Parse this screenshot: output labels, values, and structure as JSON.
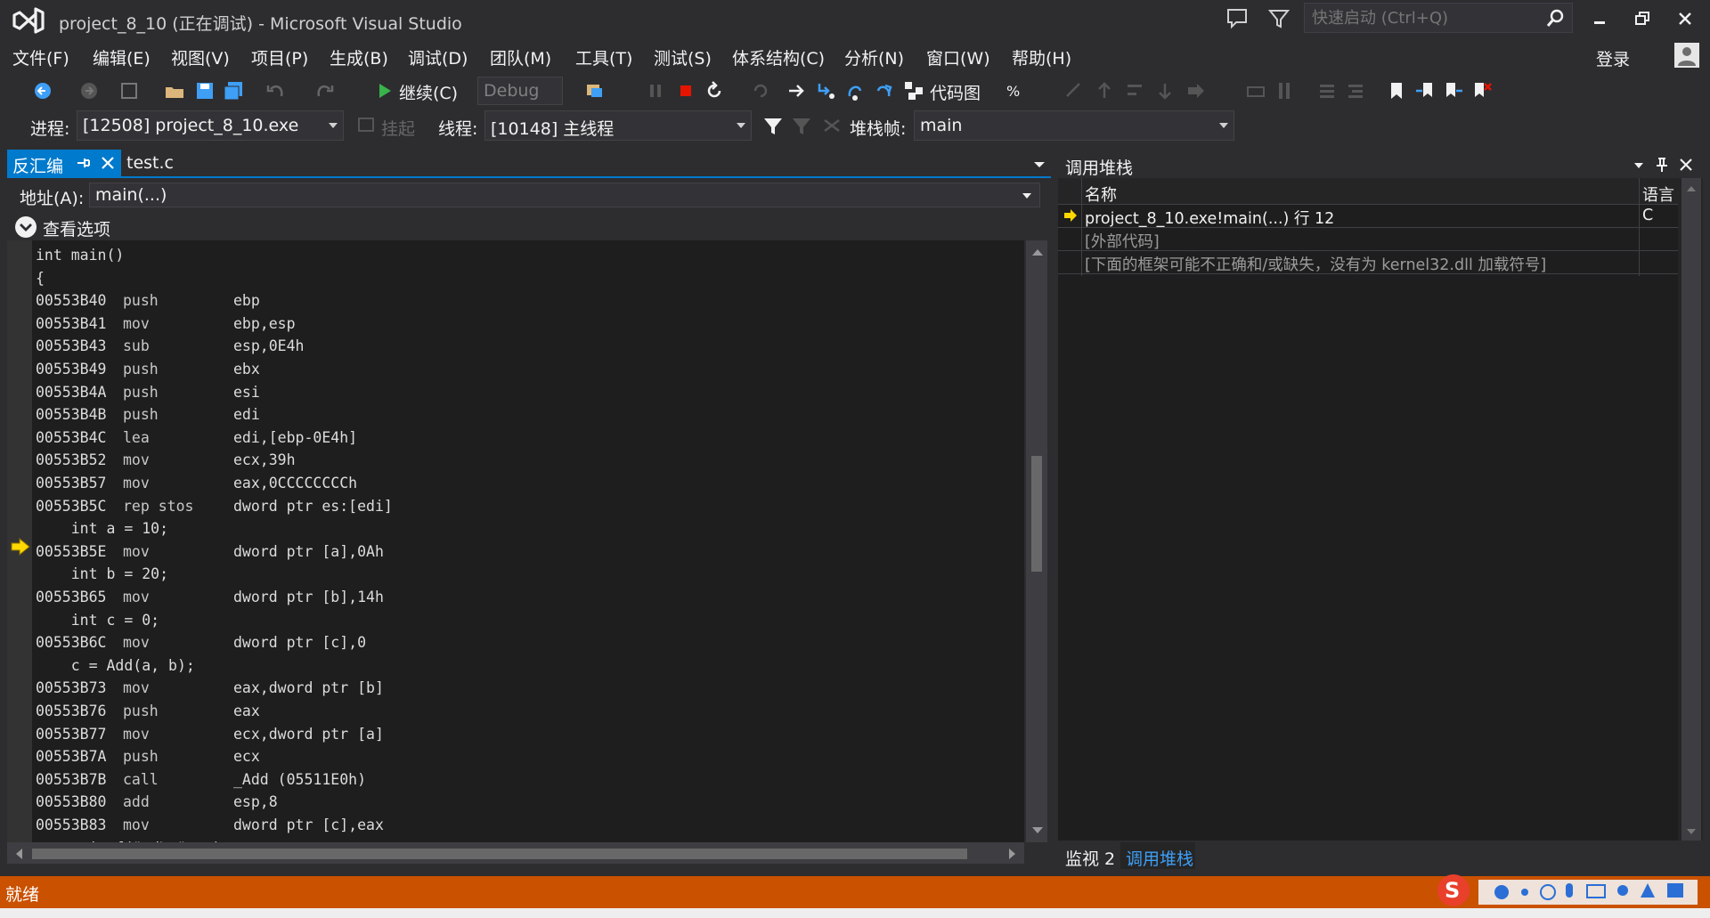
{
  "window": {
    "title": "project_8_10 (正在调试) - Microsoft Visual Studio"
  },
  "quick_launch": {
    "placeholder": "快速启动 (Ctrl+Q)"
  },
  "menu": [
    "文件(F)",
    "编辑(E)",
    "视图(V)",
    "项目(P)",
    "生成(B)",
    "调试(D)",
    "团队(M)",
    "工具(T)",
    "测试(S)",
    "体系结构(C)",
    "分析(N)",
    "窗口(W)",
    "帮助(H)"
  ],
  "account": {
    "login_label": "登录"
  },
  "toolbar": {
    "continue_label": "继续(C)",
    "config_value": "Debug",
    "codemap_label": "代码图"
  },
  "debug_location": {
    "process_label": "进程:",
    "process_value": "[12508] project_8_10.exe",
    "suspend_label": "挂起",
    "thread_label": "线程:",
    "thread_value": "[10148] 主线程",
    "stackframe_label": "堆栈帧:",
    "stackframe_value": "main"
  },
  "documents": {
    "active_tab": "反汇编",
    "other_tab": "test.c",
    "address_label": "地址(A):",
    "address_value": "main(...)",
    "view_options_label": "查看选项"
  },
  "disassembly": {
    "lines": [
      {
        "addr": "int main()",
        "op": "",
        "args": ""
      },
      {
        "addr": "{",
        "op": "",
        "args": ""
      },
      {
        "addr": "00553B40",
        "op": "push",
        "args": "ebp"
      },
      {
        "addr": "00553B41",
        "op": "mov",
        "args": "ebp,esp"
      },
      {
        "addr": "00553B43",
        "op": "sub",
        "args": "esp,0E4h"
      },
      {
        "addr": "00553B49",
        "op": "push",
        "args": "ebx"
      },
      {
        "addr": "00553B4A",
        "op": "push",
        "args": "esi"
      },
      {
        "addr": "00553B4B",
        "op": "push",
        "args": "edi"
      },
      {
        "addr": "00553B4C",
        "op": "lea",
        "args": "edi,[ebp-0E4h]"
      },
      {
        "addr": "00553B52",
        "op": "mov",
        "args": "ecx,39h"
      },
      {
        "addr": "00553B57",
        "op": "mov",
        "args": "eax,0CCCCCCCCh"
      },
      {
        "addr": "00553B5C",
        "op": "rep stos",
        "args": "dword ptr es:[edi]"
      },
      {
        "addr": "    int a = 10;",
        "op": "",
        "args": ""
      },
      {
        "addr": "00553B5E",
        "op": "mov",
        "args": "dword ptr [a],0Ah"
      },
      {
        "addr": "    int b = 20;",
        "op": "",
        "args": ""
      },
      {
        "addr": "00553B65",
        "op": "mov",
        "args": "dword ptr [b],14h"
      },
      {
        "addr": "    int c = 0;",
        "op": "",
        "args": ""
      },
      {
        "addr": "00553B6C",
        "op": "mov",
        "args": "dword ptr [c],0"
      },
      {
        "addr": "    c = Add(a, b);",
        "op": "",
        "args": ""
      },
      {
        "addr": "00553B73",
        "op": "mov",
        "args": "eax,dword ptr [b]"
      },
      {
        "addr": "00553B76",
        "op": "push",
        "args": "eax"
      },
      {
        "addr": "00553B77",
        "op": "mov",
        "args": "ecx,dword ptr [a]"
      },
      {
        "addr": "00553B7A",
        "op": "push",
        "args": "ecx"
      },
      {
        "addr": "00553B7B",
        "op": "call",
        "args": "_Add (05511E0h)"
      },
      {
        "addr": "00553B80",
        "op": "add",
        "args": "esp,8"
      },
      {
        "addr": "00553B83",
        "op": "mov",
        "args": "dword ptr [c],eax"
      },
      {
        "addr": "    printf(\"%d\\n\", c);",
        "op": "",
        "args": ""
      }
    ],
    "current_line_index": 13
  },
  "call_stack": {
    "title": "调用堆栈",
    "columns": [
      "名称",
      "语言"
    ],
    "rows": [
      {
        "name": "project_8_10.exe!main(...) 行 12",
        "lang": "C",
        "current": true
      },
      {
        "name": "[外部代码]",
        "lang": "",
        "current": false
      },
      {
        "name": "[下面的框架可能不正确和/或缺失，没有为 kernel32.dll 加载符号]",
        "lang": "",
        "current": false
      }
    ]
  },
  "bottom_tabs": {
    "watch": "监视 2",
    "callstack": "调用堆栈"
  },
  "status": {
    "text": "就绪"
  },
  "colors": {
    "accent": "#007acc",
    "status_bg": "#ca5100",
    "editor_bg": "#1e1e1e"
  }
}
